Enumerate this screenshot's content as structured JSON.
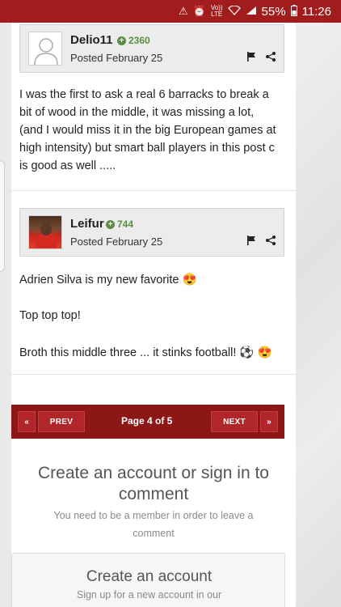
{
  "status_bar": {
    "battery": "55%",
    "time": "11:26",
    "network_top": "Vo))",
    "network_bottom": "LTE"
  },
  "posts": [
    {
      "author": "Delio11",
      "reputation": "2360",
      "posted": "Posted February 25",
      "body": [
        "I was the first to ask a real 6 barracks to break a bit of wood in the middle, it was missing a lot, (and I would miss it in the big European games at high intensity) but smart ball players in this post c is good as well ....."
      ]
    },
    {
      "author": "Leifur",
      "reputation": "744",
      "posted": "Posted February 25",
      "body": [
        "Adrien Silva is my new favorite 😍",
        "Top top top!",
        "Broth this middle three ... it stinks football! ⚽ 😍"
      ]
    }
  ],
  "pagination": {
    "first": "«",
    "prev": "PREV",
    "info": "Page 4 of 5",
    "next": "NEXT",
    "last": "»"
  },
  "cta": {
    "title": "Create an account or sign in to comment",
    "subtitle": "You need to be a member in order to leave a comment"
  },
  "create_account": {
    "title": "Create an account",
    "subtitle": "Sign up for a new account in our"
  }
}
